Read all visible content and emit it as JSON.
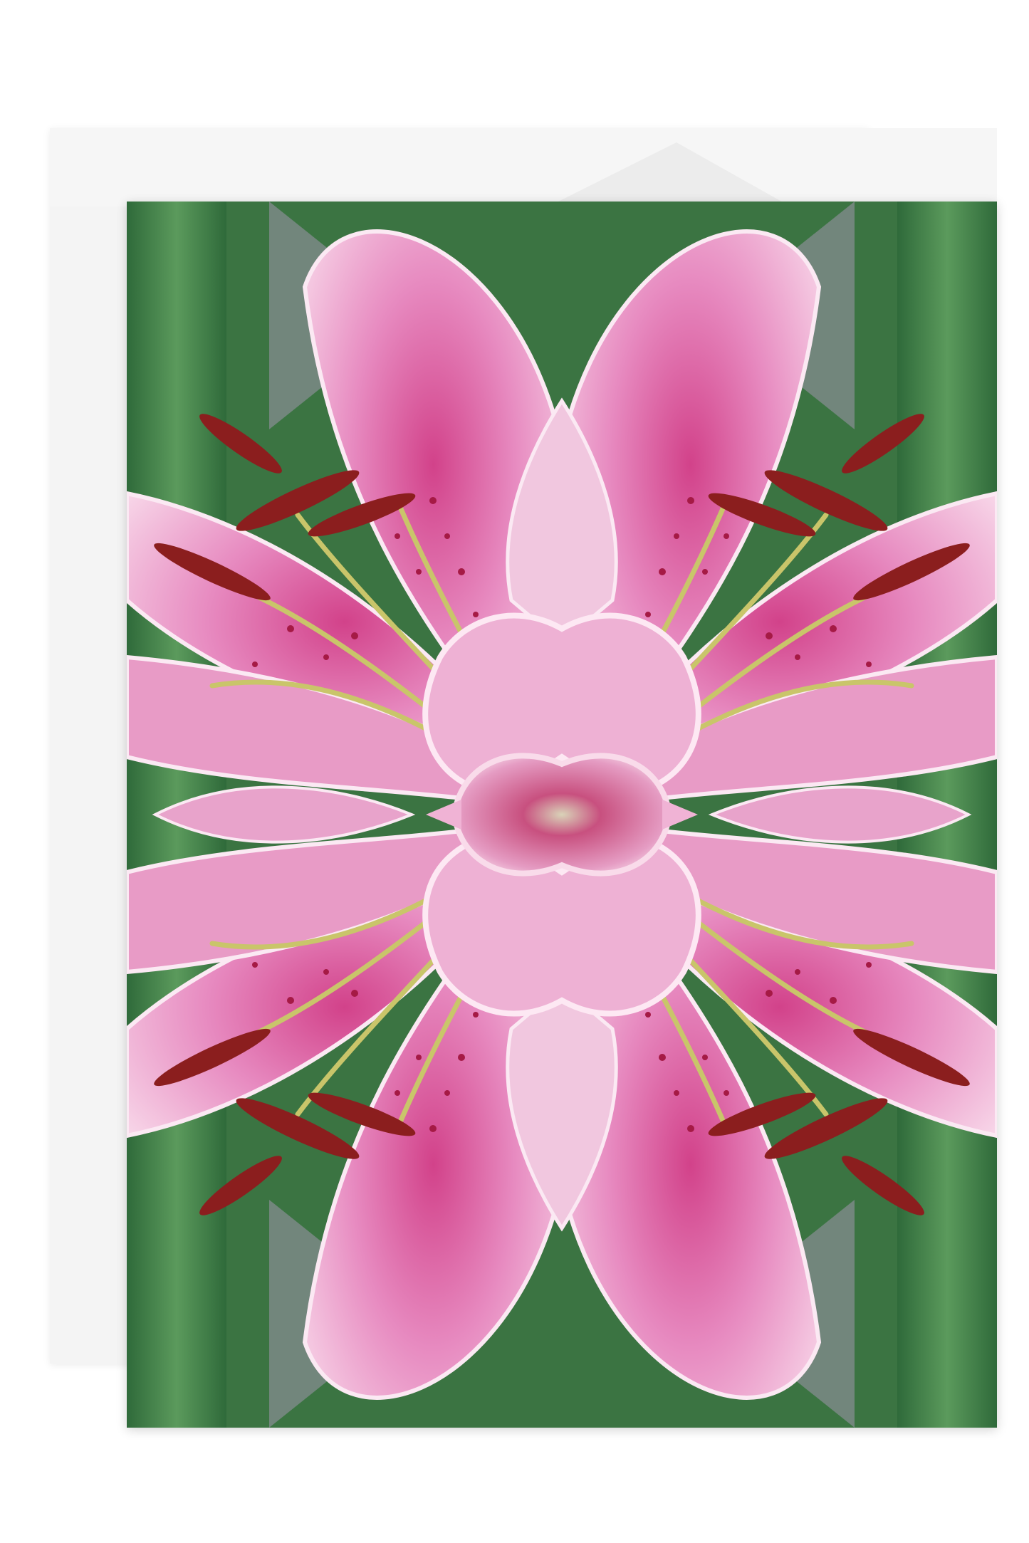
{
  "scene": {
    "description_colors": {
      "background": "#ffffff",
      "envelope": "#f4f4f4",
      "leaf_green": "#3f7a45",
      "petal_pink": "#e8a0c8",
      "petal_deep": "#c4407f",
      "stamen_red": "#8a1f1f",
      "filament": "#c4c46a"
    },
    "card_motif": "mirrored-pink-lily-kaleidoscope"
  }
}
